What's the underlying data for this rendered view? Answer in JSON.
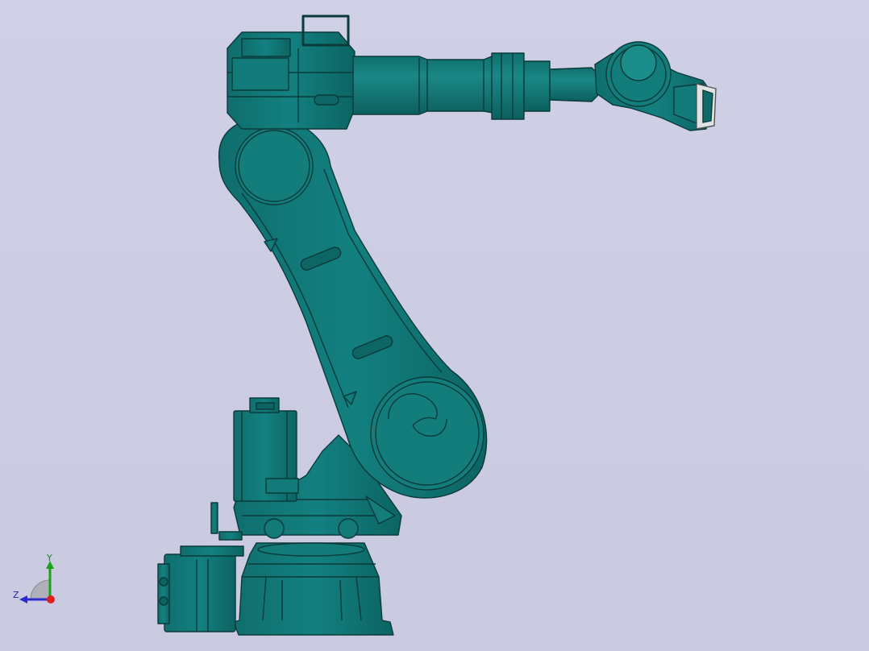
{
  "viewport": {
    "background_top": "#cfcfe6",
    "background_bottom": "#c9c9df",
    "model_color": "#0e6b6b",
    "model_edge_color": "#0b3d3d",
    "model_highlight": "#1f8a86"
  },
  "triad": {
    "y_label": "Y",
    "z_label": "Z",
    "y_color": "#1aa31a",
    "z_color": "#2a2ad0",
    "x_color": "#e02020"
  },
  "model": {
    "icon": "robot-arm-icon"
  }
}
